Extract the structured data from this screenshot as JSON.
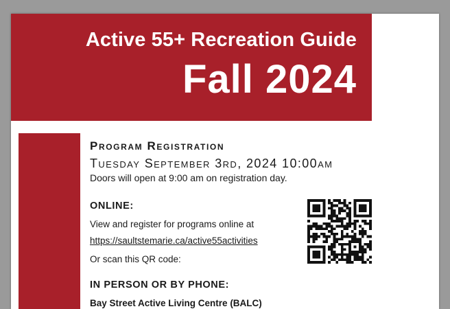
{
  "banner": {
    "subtitle": "Active 55+ Recreation Guide",
    "title": "Fall 2024"
  },
  "registration": {
    "heading": "Program Registration",
    "date": "Tuesday September 3rd, 2024 10:00am",
    "doors_note": "Doors will open at 9:00 am on registration day."
  },
  "online": {
    "heading": "ONLINE:",
    "text": "View and register for programs online at",
    "link": "https://saultstemarie.ca/active55activities",
    "qr_prompt": "Or scan this QR code:"
  },
  "in_person": {
    "heading": "IN PERSON OR BY PHONE:",
    "location": "Bay Street Active Living Centre (BALC)"
  },
  "colors": {
    "brand_red": "#a8202a",
    "page_background": "#9a9a9a"
  }
}
